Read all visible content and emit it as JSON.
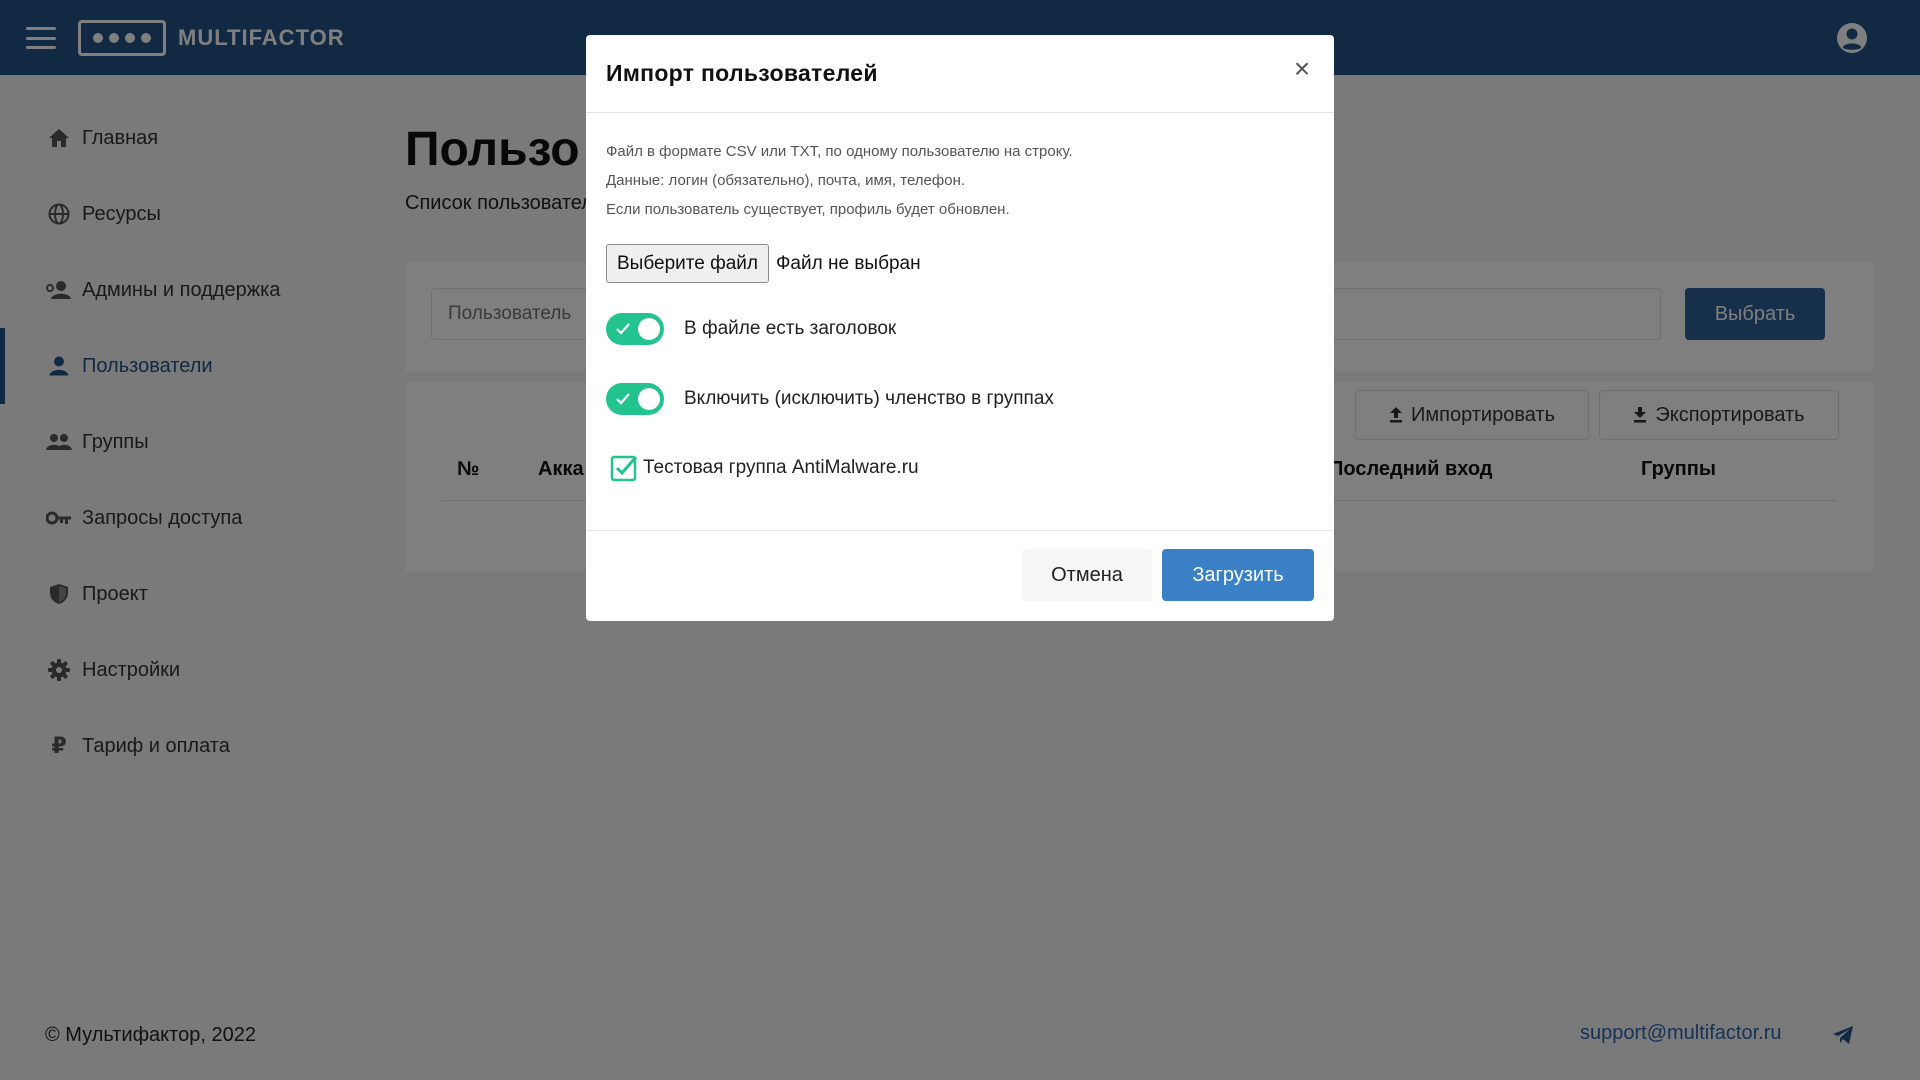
{
  "app": {
    "brand": "MULTIFACTOR",
    "menu_icon": "menu-icon",
    "account_icon": "user-circle-icon",
    "header_color": "#245286"
  },
  "sidebar": {
    "items": [
      {
        "label": "Главная",
        "icon": "home-icon",
        "active": false
      },
      {
        "label": "Ресурсы",
        "icon": "globe-icon",
        "active": false
      },
      {
        "label": "Админы и поддержка",
        "icon": "admin-users-icon",
        "active": false
      },
      {
        "label": "Пользователи",
        "icon": "user-icon",
        "active": true
      },
      {
        "label": "Группы",
        "icon": "group-icon",
        "active": false
      },
      {
        "label": "Запросы доступа",
        "icon": "key-icon",
        "active": false
      },
      {
        "label": "Проект",
        "icon": "shield-icon",
        "active": false
      },
      {
        "label": "Настройки",
        "icon": "gear-icon",
        "active": false
      },
      {
        "label": "Тариф и оплата",
        "icon": "ruble-icon",
        "active": false
      }
    ]
  },
  "main": {
    "title": "Пользо",
    "subtitle": "Список пользовател",
    "filter": {
      "placeholder": "Пользователь",
      "select_label": "Выбрать"
    },
    "actions": {
      "import_label": "Импортировать",
      "export_label": "Экспортировать"
    },
    "columns": [
      "№",
      "Акка",
      "Последний вход",
      "Группы"
    ]
  },
  "modal": {
    "title": "Импорт пользователей",
    "close_symbol": "×",
    "help": [
      "Файл в формате CSV или TXT, по одному пользователю на строку.",
      "Данные: логин (обязательно), почта, имя, телефон.",
      "Если пользователь существует, профиль будет обновлен."
    ],
    "file_button": "Выберите файл",
    "file_status": "Файл не выбран",
    "toggle_header": {
      "label": "В файле есть заголовок",
      "on": true
    },
    "toggle_groups": {
      "label": "Включить (исключить) членство в группах",
      "on": true
    },
    "group_checkbox": {
      "label": "Тестовая группа AntiMalware.ru",
      "checked": true
    },
    "cancel_label": "Отмена",
    "upload_label": "Загрузить",
    "accent_green": "#22c38e",
    "primary_blue": "#3a80c6"
  },
  "footer": {
    "copyright": "© Мультифактор, 2022",
    "email": "support@multifactor.ru",
    "telegram_icon": "telegram-icon"
  }
}
